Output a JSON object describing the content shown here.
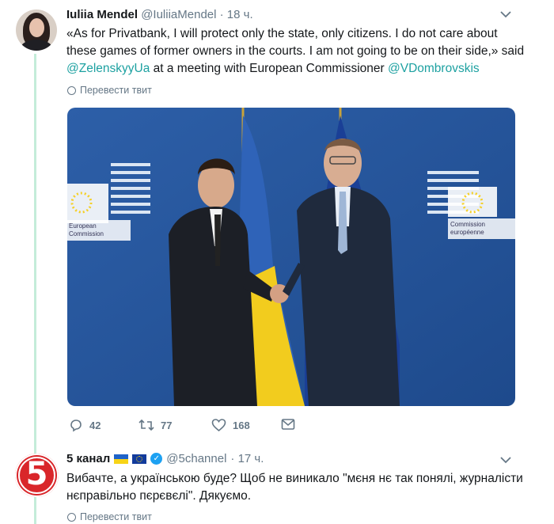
{
  "tweet1": {
    "author_name": "Iuliia Mendel",
    "author_handle": "@IuliiaMendel",
    "time": "· 18 ч.",
    "text_part1": "«As for Privatbank, I will protect only the state, only citizens. I do not care about these games of former owners in the courts. I am not going to be on their side,» said ",
    "mention1": "@ZelenskyyUa",
    "text_part2": " at a meeting with European Commissioner ",
    "mention2": "@VDombrovskis",
    "translate": "Перевести твит",
    "photo_signs": {
      "left_line1": "European",
      "left_line2": "Commission",
      "right_line1": "Commission",
      "right_line2": "européenne"
    },
    "actions": {
      "replies": "42",
      "retweets": "77",
      "likes": "168"
    }
  },
  "tweet2": {
    "avatar_digit": "5",
    "author_name": "5 канал",
    "author_handle": "@5channel",
    "time": "· 17 ч.",
    "text": "Вибачте, а українською буде? Щоб не виникало \"мєня нє так понялі, журналісти нєправільно пєрєвєлі\". Дякуємо.",
    "translate": "Перевести твит"
  },
  "colors": {
    "mention": "#1da1a1",
    "thread_line": "#c4ecd9",
    "muted": "#657786",
    "channel_red": "#d9262a"
  }
}
